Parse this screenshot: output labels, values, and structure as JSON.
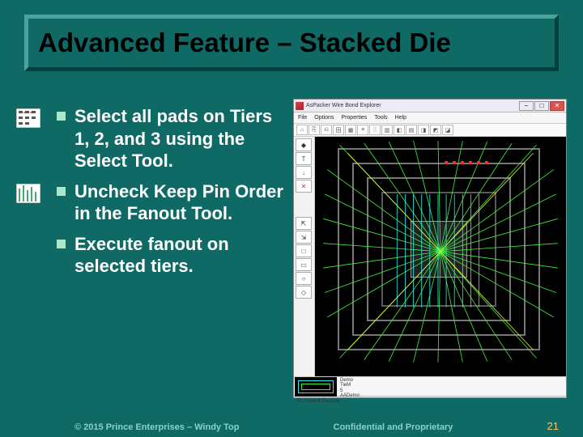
{
  "title": "Advanced Feature – Stacked Die",
  "bullets": [
    {
      "icon": "select-tool-icon",
      "text": "Select all pads on Tiers 1, 2, and 3 using the Select Tool."
    },
    {
      "icon": "fanout-tool-icon",
      "text": "Uncheck Keep Pin Order in the Fanout Tool."
    },
    {
      "icon": "square",
      "text": "Execute fanout on selected tiers."
    }
  ],
  "screenshot": {
    "app_icon": "app-icon",
    "window_title": "AsPacker Wire Bond Explorer",
    "window_buttons": {
      "min": "–",
      "max": "□",
      "close": "✕"
    },
    "menu": [
      "File",
      "Options",
      "Properties",
      "Tools",
      "Help"
    ],
    "toolbar_icons": [
      "⌂",
      "⎘",
      "⎌",
      "田",
      "▦",
      "≡",
      "░",
      "▥",
      "◧",
      "▤",
      "◨",
      "◩",
      "◪"
    ],
    "left_tools": [
      {
        "g": "◆"
      },
      {
        "g": "T",
        "cls": "g"
      },
      {
        "g": "↓",
        "cls": "g"
      },
      {
        "g": "✕",
        "cls": "r"
      },
      {
        "g": ""
      },
      {
        "g": ""
      },
      {
        "g": ""
      },
      {
        "g": ""
      },
      {
        "g": "⇱"
      },
      {
        "g": "⇲"
      },
      {
        "g": "□"
      },
      {
        "g": "▭"
      },
      {
        "g": "○"
      },
      {
        "g": "◇"
      }
    ],
    "list_items": [
      "Demo",
      "TieM",
      "5",
      "AADemo"
    ],
    "status": "51: Fanout.Execute"
  },
  "footer": {
    "copyright": "© 2015 Prince Enterprises – Windy Top",
    "confidential": "Confidential and Proprietary",
    "page": "21"
  }
}
